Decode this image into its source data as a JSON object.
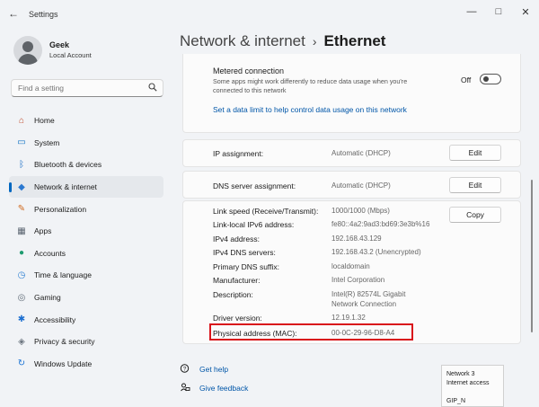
{
  "window": {
    "app_title": "Settings",
    "back_glyph": "←",
    "min_glyph": "—",
    "max_glyph": "□",
    "close_glyph": "✕"
  },
  "user": {
    "name": "Geek",
    "account_type": "Local Account"
  },
  "search": {
    "placeholder": "Find a setting",
    "icon": "search-icon"
  },
  "sidebar": {
    "items": [
      {
        "label": "Home",
        "icon": "home-icon",
        "glyph": "⌂",
        "color": "#c04a2a",
        "active": false
      },
      {
        "label": "System",
        "icon": "system-icon",
        "glyph": "▭",
        "color": "#0a6ec2",
        "active": false
      },
      {
        "label": "Bluetooth & devices",
        "icon": "bluetooth-icon",
        "glyph": "ᛒ",
        "color": "#1b6fc6",
        "active": false
      },
      {
        "label": "Network & internet",
        "icon": "network-icon",
        "glyph": "◆",
        "color": "#2b78d0",
        "active": true
      },
      {
        "label": "Personalization",
        "icon": "personalization-icon",
        "glyph": "✎",
        "color": "#d06a1e",
        "active": false
      },
      {
        "label": "Apps",
        "icon": "apps-icon",
        "glyph": "▦",
        "color": "#5b6571",
        "active": false
      },
      {
        "label": "Accounts",
        "icon": "accounts-icon",
        "glyph": "●",
        "color": "#1f9c70",
        "active": false
      },
      {
        "label": "Time & language",
        "icon": "time-language-icon",
        "glyph": "◷",
        "color": "#2d7fd2",
        "active": false
      },
      {
        "label": "Gaming",
        "icon": "gaming-icon",
        "glyph": "◎",
        "color": "#5f6a76",
        "active": false
      },
      {
        "label": "Accessibility",
        "icon": "accessibility-icon",
        "glyph": "✱",
        "color": "#1d6fd0",
        "active": false
      },
      {
        "label": "Privacy & security",
        "icon": "privacy-shield-icon",
        "glyph": "◈",
        "color": "#6d7680",
        "active": false
      },
      {
        "label": "Windows Update",
        "icon": "windows-update-icon",
        "glyph": "↻",
        "color": "#1a73d4",
        "active": false
      }
    ]
  },
  "header": {
    "parent": "Network & internet",
    "separator": "›",
    "current": "Ethernet"
  },
  "metered": {
    "title": "Metered connection",
    "description": "Some apps might work differently to reduce data usage when you're connected to this network",
    "state_label": "Off",
    "on": false,
    "data_limit_link": "Set a data limit to help control data usage on this network"
  },
  "ip_assignment": {
    "label": "IP assignment:",
    "value": "Automatic (DHCP)",
    "button": "Edit"
  },
  "dns_assignment": {
    "label": "DNS server assignment:",
    "value": "Automatic (DHCP)",
    "button": "Edit"
  },
  "properties": {
    "copy_button": "Copy",
    "rows": [
      {
        "label": "Link speed (Receive/Transmit):",
        "value": "1000/1000 (Mbps)"
      },
      {
        "label": "Link-local IPv6 address:",
        "value": "fe80::4a2:9ad3:bd69:3e3b%16"
      },
      {
        "label": "IPv4 address:",
        "value": "192.168.43.129"
      },
      {
        "label": "IPv4 DNS servers:",
        "value": "192.168.43.2 (Unencrypted)"
      },
      {
        "label": "Primary DNS suffix:",
        "value": "localdomain"
      },
      {
        "label": "Manufacturer:",
        "value": "Intel Corporation"
      },
      {
        "label": "Description:",
        "value": "Intel(R) 82574L Gigabit",
        "value2": "Network Connection"
      },
      {
        "label": "Driver version:",
        "value": "12.19.1.32"
      },
      {
        "label": "Physical address (MAC):",
        "value": "00-0C-29-96-D8-A4"
      }
    ],
    "highlight_color": "#d9141b"
  },
  "help": {
    "get_help": "Get help",
    "give_feedback": "Give feedback"
  },
  "tooltip": {
    "line1": "Network 3",
    "line2": "Internet access",
    "line3": "GIP_N"
  }
}
